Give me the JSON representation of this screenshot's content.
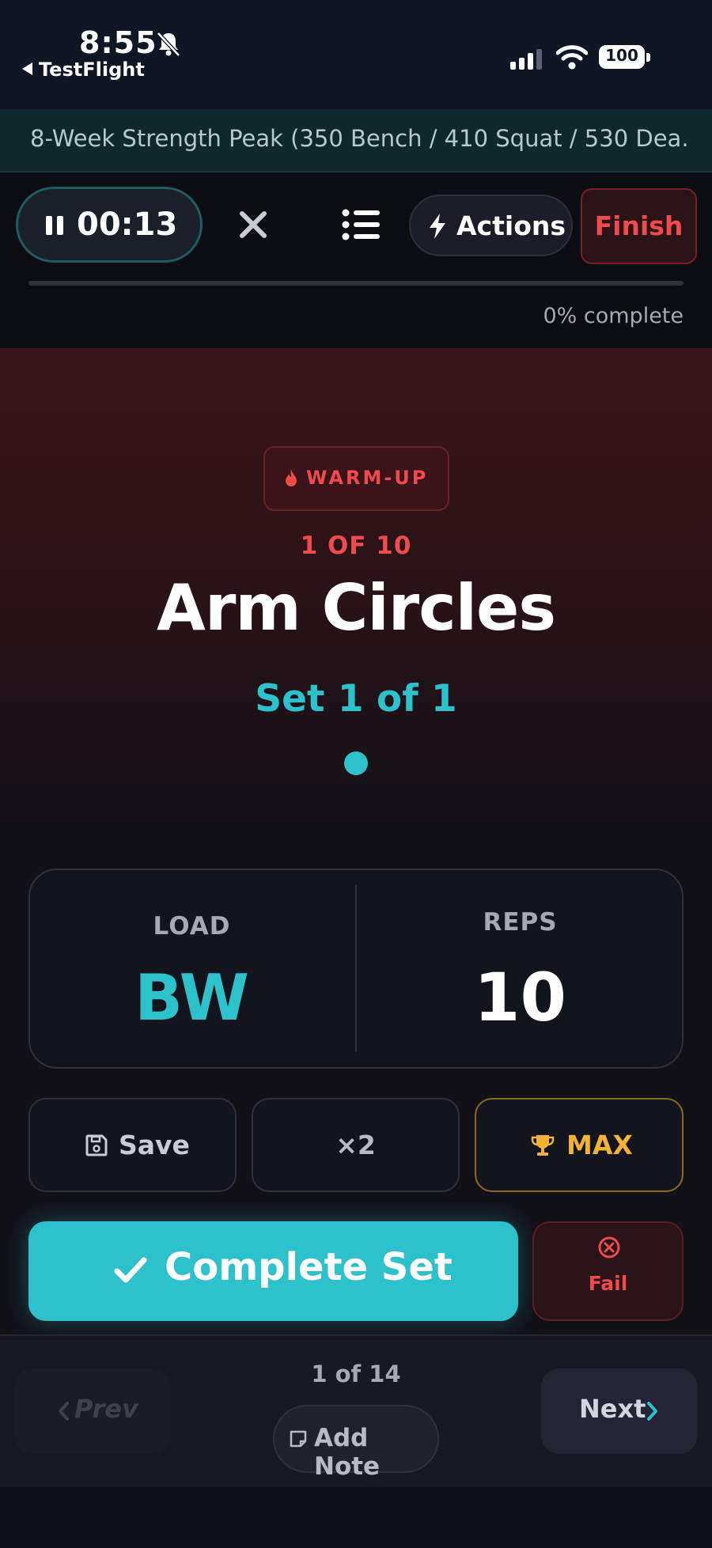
{
  "status_bar": {
    "time": "8:55",
    "back_app": "TestFlight",
    "battery": "100"
  },
  "program": {
    "title": "8-Week Strength Peak (350 Bench / 410 Squat / 530 Dea..."
  },
  "toolbar": {
    "timer": "00:13",
    "actions_label": "Actions",
    "finish_label": "Finish",
    "progress_percent": 0,
    "progress_text": "0% complete"
  },
  "exercise": {
    "badge": "WARM-UP",
    "counter": "1 OF 10",
    "name": "Arm Circles",
    "set_label": "Set 1 of 1",
    "set_dots": 1
  },
  "metrics": {
    "load_label": "LOAD",
    "load_value": "BW",
    "reps_label": "REPS",
    "reps_value": "10"
  },
  "quick_actions": {
    "save_label": "Save",
    "x2_label": "×2",
    "max_label": "MAX"
  },
  "primary": {
    "complete_label": "Complete Set",
    "fail_label": "Fail"
  },
  "nav": {
    "prev_label": "Prev",
    "page_count": "1 of 14",
    "note_label": "Add Note",
    "next_label": "Next"
  },
  "colors": {
    "accent": "#2cc1cb",
    "danger": "#ef4b4f",
    "gold": "#f2b233",
    "background": "#0e0f16"
  }
}
